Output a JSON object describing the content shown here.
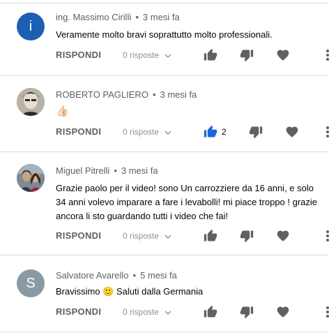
{
  "comments": [
    {
      "author": "ing. Massimo Cirilli",
      "time": "3 mesi fa",
      "avatar_letter": "i",
      "avatar_color": "#1e5fb4",
      "text": "Veramente molto bravi soprattutto molto professionali.",
      "reply_label": "RISPONDI",
      "replies_label": "0 risposte",
      "like_count": "",
      "liked": false
    },
    {
      "author": "ROBERTO PAGLIERO",
      "time": "3 mesi fa",
      "avatar_letter": "",
      "avatar_color": "#8a8277",
      "text": "👍🏻",
      "reply_label": "RISPONDI",
      "replies_label": "0 risposte",
      "like_count": "2",
      "liked": true
    },
    {
      "author": "Miguel Pitrelli",
      "time": "3 mesi fa",
      "avatar_letter": "",
      "avatar_color": "#5a6b7a",
      "text": "Grazie paolo per il video! sono Un carrozziere da 16 anni, e solo 34 anni volevo imparare a fare i levabolli! mi piace troppo ! grazie ancora li sto guardando tutti i video che fai!",
      "reply_label": "RISPONDI",
      "replies_label": "0 risposte",
      "like_count": "",
      "liked": false
    },
    {
      "author": "Salvatore Avarello",
      "time": "5 mesi fa",
      "avatar_letter": "S",
      "avatar_color": "#8a9aa4",
      "text": "Bravissimo 🙂 Saluti dalla Germania",
      "reply_label": "RISPONDI",
      "replies_label": "0 risposte",
      "like_count": "",
      "liked": false
    }
  ],
  "colors": {
    "like_active": "#1e66d6",
    "icon": "#606060"
  },
  "icons": [
    "thumb-up-icon",
    "thumb-down-icon",
    "heart-icon",
    "more-vert-icon",
    "chevron-down-icon"
  ]
}
